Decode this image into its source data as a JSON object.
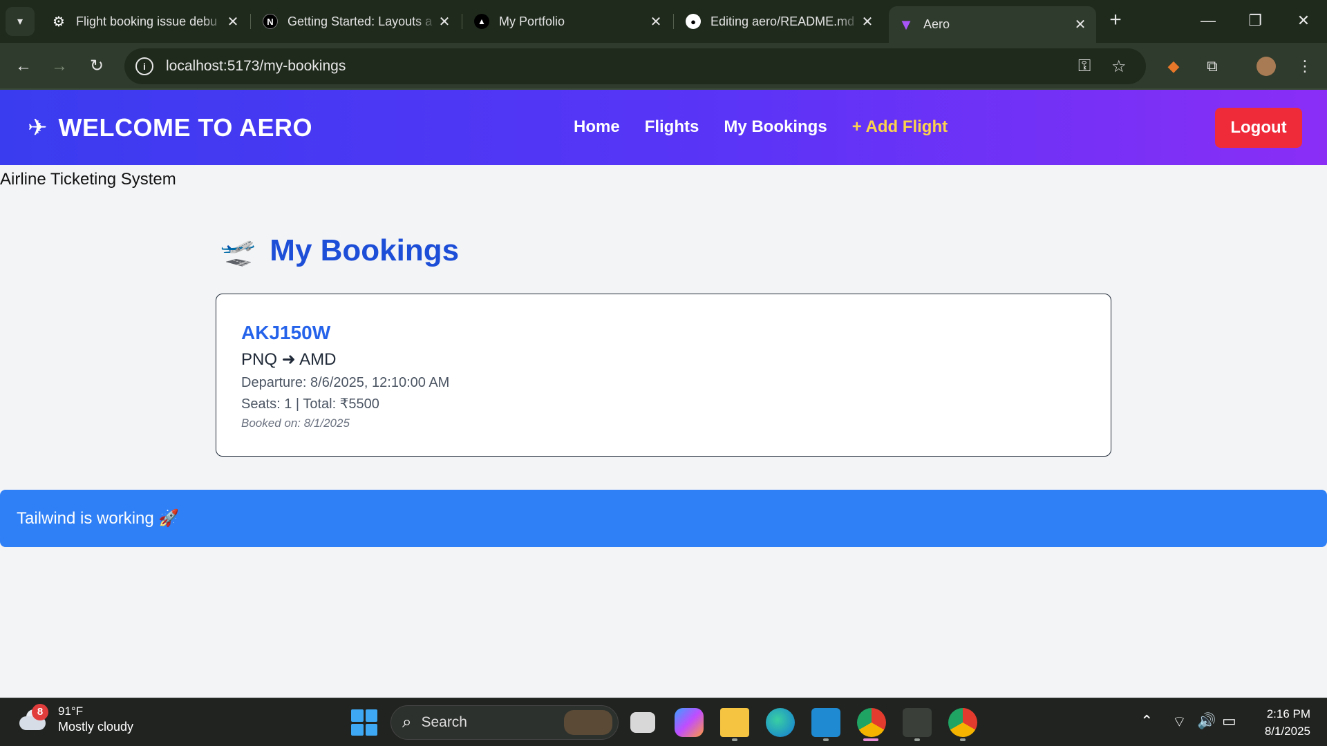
{
  "browser": {
    "tabs": [
      {
        "title": "Flight booking issue debu",
        "icon": "openai-icon"
      },
      {
        "title": "Getting Started: Layouts a",
        "icon": "nextjs-icon"
      },
      {
        "title": "My Portfolio",
        "icon": "triangle-icon"
      },
      {
        "title": "Editing aero/README.md",
        "icon": "github-icon"
      },
      {
        "title": "Aero",
        "icon": "vite-icon",
        "active": true
      }
    ],
    "url": "localhost:5173/my-bookings"
  },
  "page": {
    "brand": "WELCOME TO AERO",
    "nav": {
      "home": "Home",
      "flights": "Flights",
      "my_bookings": "My Bookings",
      "add_flight": "+ Add Flight"
    },
    "logout": "Logout",
    "subtitle": "Airline Ticketing System",
    "heading": "My Bookings",
    "bookings": [
      {
        "code": "AKJ150W",
        "route": "PNQ ➜ AMD",
        "departure": "Departure: 8/6/2025, 12:10:00 AM",
        "seats_total": "Seats: 1 | Total: ₹5500",
        "booked_on": "Booked on: 8/1/2025"
      }
    ],
    "tailwind_banner": "Tailwind is working 🚀"
  },
  "taskbar": {
    "weather_badge": "8",
    "temp": "91°F",
    "condition": "Mostly cloudy",
    "search_placeholder": "Search",
    "time": "2:16 PM",
    "date": "8/1/2025"
  },
  "colors": {
    "navbar_start": "#3a3cf0",
    "navbar_end": "#8a2ef6",
    "heading": "#1d4ed8",
    "logout": "#ef2b3a",
    "banner": "#2f80f6",
    "add_flight": "#fcd34d"
  }
}
